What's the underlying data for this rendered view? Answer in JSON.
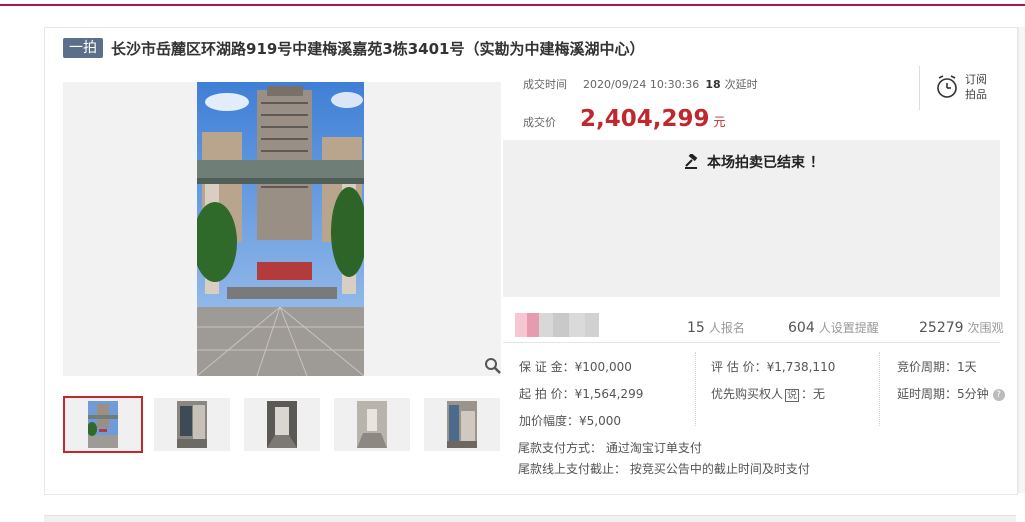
{
  "header": {
    "badge": "一拍",
    "title": "长沙市岳麓区环湖路919号中建梅溪嘉苑3栋3401号（实勘为中建梅溪湖中心）"
  },
  "auction": {
    "deal_time_label": "成交时间",
    "deal_time": "2020/09/24 10:30:36",
    "extensions": "18",
    "extensions_label": "次延时",
    "price_label": "成交价",
    "price": "2,404,299",
    "price_unit": "元",
    "subscribe_line1": "订阅",
    "subscribe_line2": "拍品",
    "ended_message": "本场拍卖已结束 ！"
  },
  "stats": {
    "signups": "15",
    "signups_label": "人报名",
    "reminders": "604",
    "reminders_label": "人设置提醒",
    "views": "25279",
    "views_label": "次围观"
  },
  "details": {
    "deposit": "保 证 金：¥100,000",
    "start_price": "起 拍 价：¥1,564,299",
    "increment": "加价幅度：¥5,000",
    "appraisal": "评 估 价：¥1,738,110",
    "priority_prefix": "优先购买权人",
    "priority_suffix": "：无",
    "priority_icon_text": "说",
    "bid_period": "竞价周期：1天",
    "delay_period": "延时周期：5分钟",
    "help_glyph": "?"
  },
  "payment": {
    "method": "尾款支付方式： 通过淘宝订单支付",
    "deadline": "尾款线上支付截止： 按竞买公告中的截止时间及时支付"
  },
  "colors": {
    "accent": "#c0282e",
    "badge_bg": "#5b6f8b",
    "top_line": "#b0154f"
  },
  "icons": [
    "alarm-clock-icon",
    "gavel-icon",
    "zoom-icon",
    "help-icon"
  ]
}
